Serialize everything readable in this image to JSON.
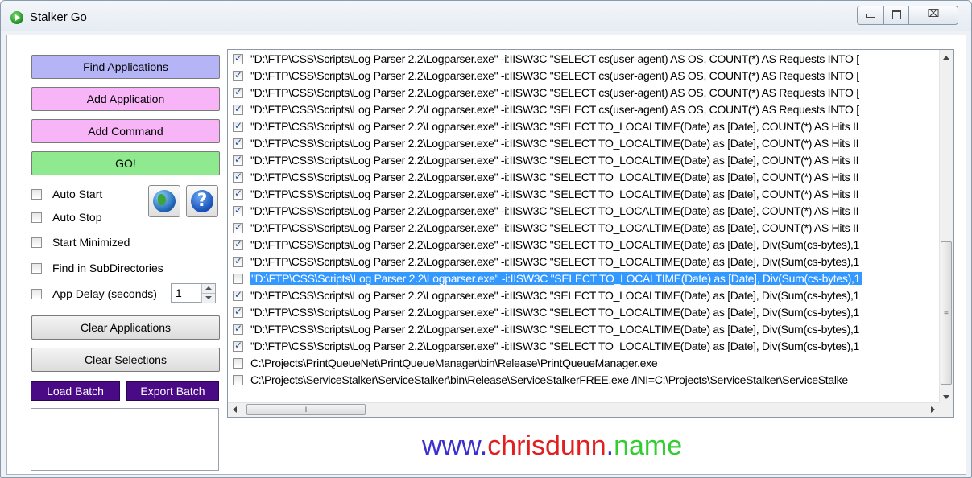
{
  "window": {
    "title": "Stalker Go",
    "controls": {
      "minimize": "minimize",
      "maximize": "maximize",
      "close": "⌧"
    }
  },
  "buttons": {
    "find_applications": "Find Applications",
    "add_application": "Add Application",
    "add_command": "Add Command",
    "go": "GO!",
    "clear_applications": "Clear Applications",
    "clear_selections": "Clear Selections",
    "load_batch": "Load Batch",
    "export_batch": "Export Batch"
  },
  "options": {
    "auto_start": {
      "label": "Auto Start",
      "checked": false
    },
    "auto_stop": {
      "label": "Auto Stop",
      "checked": false
    },
    "start_minimized": {
      "label": "Start Minimized",
      "checked": false
    },
    "find_in_subdirectories": {
      "label": "Find in SubDirectories",
      "checked": false
    },
    "app_delay": {
      "label": "App Delay (seconds)",
      "checked": false,
      "value": "1"
    }
  },
  "icons": {
    "website": "globe-icon",
    "help": "help-icon"
  },
  "commands": [
    {
      "checked": true,
      "text": "\"D:\\FTP\\CSS\\Scripts\\Log Parser 2.2\\Logparser.exe\" -i:IISW3C \"SELECT cs(user-agent) AS OS, COUNT(*) AS Requests INTO ["
    },
    {
      "checked": true,
      "text": "\"D:\\FTP\\CSS\\Scripts\\Log Parser 2.2\\Logparser.exe\" -i:IISW3C \"SELECT cs(user-agent) AS OS, COUNT(*) AS Requests INTO ["
    },
    {
      "checked": true,
      "text": "\"D:\\FTP\\CSS\\Scripts\\Log Parser 2.2\\Logparser.exe\" -i:IISW3C \"SELECT cs(user-agent) AS OS, COUNT(*) AS Requests INTO ["
    },
    {
      "checked": true,
      "text": "\"D:\\FTP\\CSS\\Scripts\\Log Parser 2.2\\Logparser.exe\" -i:IISW3C \"SELECT cs(user-agent) AS OS, COUNT(*) AS Requests INTO ["
    },
    {
      "checked": true,
      "text": "\"D:\\FTP\\CSS\\Scripts\\Log Parser 2.2\\Logparser.exe\" -i:IISW3C \"SELECT TO_LOCALTIME(Date) as [Date], COUNT(*) AS Hits II"
    },
    {
      "checked": true,
      "text": "\"D:\\FTP\\CSS\\Scripts\\Log Parser 2.2\\Logparser.exe\" -i:IISW3C \"SELECT TO_LOCALTIME(Date) as [Date], COUNT(*) AS Hits II"
    },
    {
      "checked": true,
      "text": "\"D:\\FTP\\CSS\\Scripts\\Log Parser 2.2\\Logparser.exe\" -i:IISW3C \"SELECT TO_LOCALTIME(Date) as [Date], COUNT(*) AS Hits II"
    },
    {
      "checked": true,
      "text": "\"D:\\FTP\\CSS\\Scripts\\Log Parser 2.2\\Logparser.exe\" -i:IISW3C \"SELECT TO_LOCALTIME(Date) as [Date], COUNT(*) AS Hits II"
    },
    {
      "checked": true,
      "text": "\"D:\\FTP\\CSS\\Scripts\\Log Parser 2.2\\Logparser.exe\" -i:IISW3C \"SELECT TO_LOCALTIME(Date) as [Date], COUNT(*) AS Hits II"
    },
    {
      "checked": true,
      "text": "\"D:\\FTP\\CSS\\Scripts\\Log Parser 2.2\\Logparser.exe\" -i:IISW3C \"SELECT TO_LOCALTIME(Date) as [Date], COUNT(*) AS Hits II"
    },
    {
      "checked": true,
      "text": "\"D:\\FTP\\CSS\\Scripts\\Log Parser 2.2\\Logparser.exe\" -i:IISW3C \"SELECT TO_LOCALTIME(Date) as [Date], COUNT(*) AS Hits II"
    },
    {
      "checked": true,
      "text": "\"D:\\FTP\\CSS\\Scripts\\Log Parser 2.2\\Logparser.exe\" -i:IISW3C \"SELECT TO_LOCALTIME(Date) as [Date], Div(Sum(cs-bytes),1"
    },
    {
      "checked": true,
      "text": "\"D:\\FTP\\CSS\\Scripts\\Log Parser 2.2\\Logparser.exe\" -i:IISW3C \"SELECT TO_LOCALTIME(Date) as [Date], Div(Sum(cs-bytes),1"
    },
    {
      "checked": false,
      "selected": true,
      "text": "\"D:\\FTP\\CSS\\Scripts\\Log Parser 2.2\\Logparser.exe\" -i:IISW3C \"SELECT TO_LOCALTIME(Date) as [Date], Div(Sum(cs-bytes),1"
    },
    {
      "checked": true,
      "text": "\"D:\\FTP\\CSS\\Scripts\\Log Parser 2.2\\Logparser.exe\" -i:IISW3C \"SELECT TO_LOCALTIME(Date) as [Date], Div(Sum(cs-bytes),1"
    },
    {
      "checked": true,
      "text": "\"D:\\FTP\\CSS\\Scripts\\Log Parser 2.2\\Logparser.exe\" -i:IISW3C \"SELECT TO_LOCALTIME(Date) as [Date], Div(Sum(cs-bytes),1"
    },
    {
      "checked": true,
      "text": "\"D:\\FTP\\CSS\\Scripts\\Log Parser 2.2\\Logparser.exe\" -i:IISW3C \"SELECT TO_LOCALTIME(Date) as [Date], Div(Sum(cs-bytes),1"
    },
    {
      "checked": true,
      "text": "\"D:\\FTP\\CSS\\Scripts\\Log Parser 2.2\\Logparser.exe\" -i:IISW3C \"SELECT TO_LOCALTIME(Date) as [Date], Div(Sum(cs-bytes),1"
    },
    {
      "checked": false,
      "text": "C:\\Projects\\PrintQueueNet\\PrintQueueManager\\bin\\Release\\PrintQueueManager.exe"
    },
    {
      "checked": false,
      "text": "C:\\Projects\\ServiceStalker\\ServiceStalker\\bin\\Release\\ServiceStalkerFREE.exe /INI=C:\\Projects\\ServiceStalker\\ServiceStalke"
    }
  ],
  "scrollbar": {
    "hthumb_grip": "III",
    "vthumb_grip": "≡"
  },
  "footer": {
    "segments": [
      {
        "text": "www.",
        "color": "#3b2fd0"
      },
      {
        "text": "chrisdunn",
        "color": "#e02020"
      },
      {
        "text": ".",
        "color": "#3b2fd0"
      },
      {
        "text": "name",
        "color": "#33cc33"
      }
    ]
  },
  "colors": {
    "find_button": "#b4b4f7",
    "add_button": "#f7b4f7",
    "go_button": "#8fea8f",
    "batch_button": "#4a0a86",
    "selection": "#3399ff"
  }
}
